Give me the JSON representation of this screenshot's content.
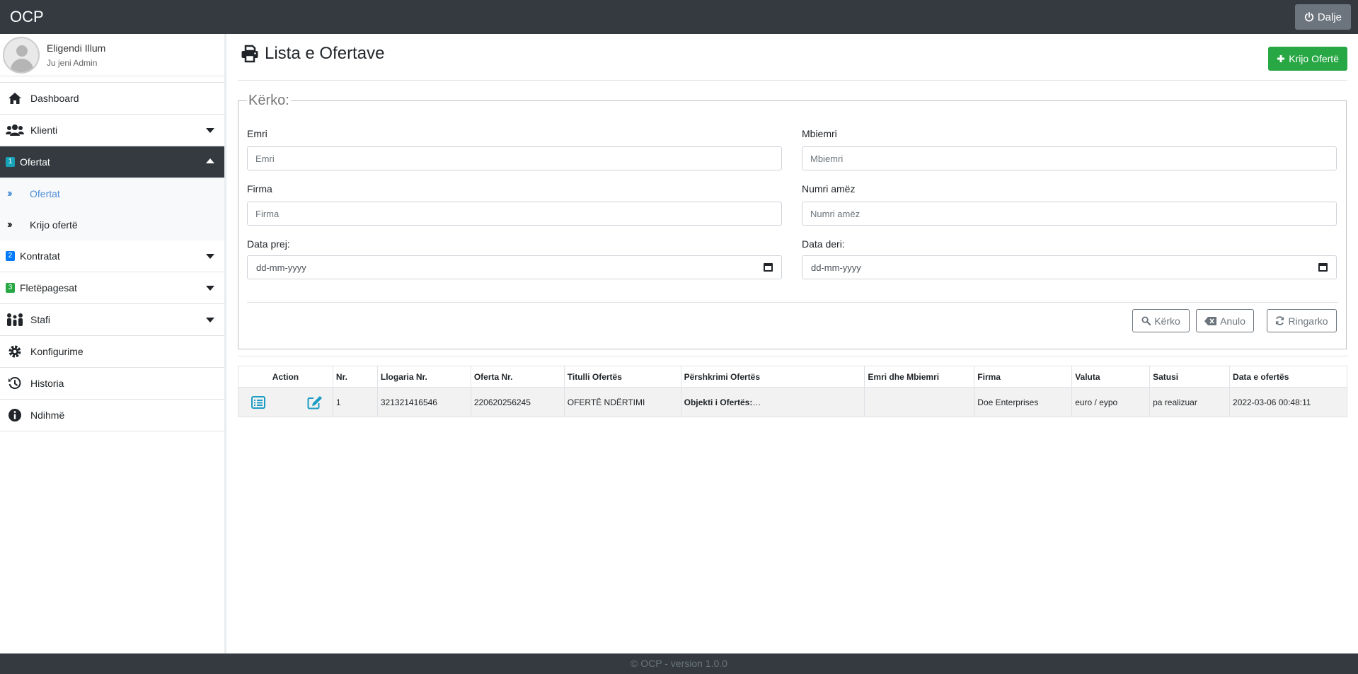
{
  "app": {
    "brand": "OCP"
  },
  "header": {
    "logout_label": "Dalje"
  },
  "user": {
    "name": "Eligendi Illum",
    "role": "Ju jeni Admin"
  },
  "sidebar": {
    "items": [
      {
        "label": "Dashboard"
      },
      {
        "label": "Klienti"
      },
      {
        "label": "Ofertat",
        "badge": "1"
      },
      {
        "label": "Kontratat",
        "badge": "2"
      },
      {
        "label": "Fletëpagesat",
        "badge": "3"
      },
      {
        "label": "Stafi"
      },
      {
        "label": "Konfigurime"
      },
      {
        "label": "Historia"
      },
      {
        "label": "Ndihmë"
      }
    ],
    "submenu": [
      {
        "label": "Ofertat"
      },
      {
        "label": "Krijo ofertë"
      }
    ]
  },
  "page": {
    "title": "Lista e Ofertave",
    "create_label": "Krijo Ofertë"
  },
  "search": {
    "legend": "Kërko:",
    "emri_label": "Emri",
    "emri_placeholder": "Emri",
    "mbiemri_label": "Mbiemri",
    "mbiemri_placeholder": "Mbiemri",
    "firma_label": "Firma",
    "firma_placeholder": "Firma",
    "numri_label": "Numri amëz",
    "numri_placeholder": "Numri amëz",
    "data_prej_label": "Data prej:",
    "data_prej_value": "dd-mm-yyyy",
    "data_deri_label": "Data deri:",
    "data_deri_value": "dd-mm-yyyy",
    "search_btn": "Kërko",
    "cancel_btn": "Anulo",
    "reload_btn": "Ringarko"
  },
  "table": {
    "headers": [
      "Action",
      "Nr.",
      "Llogaria Nr.",
      "Oferta Nr.",
      "Titulli Ofertës",
      "Përshkrimi Ofertës",
      "Emri dhe Mbiemri",
      "Firma",
      "Valuta",
      "Satusi",
      "Data e ofertës"
    ],
    "rows": [
      {
        "nr": "1",
        "llogaria": "321321416546",
        "oferta": "220620256245",
        "titulli": "OFERTË NDËRTIMI",
        "pershkrimi_bold": "Objekti i Ofertës:",
        "pershkrimi_rest": "…",
        "emri": "",
        "firma": "Doe Enterprises",
        "valuta": "euro / eypo",
        "statusi": "pa realizuar",
        "data": "2022-03-06 00:48:11"
      }
    ]
  },
  "footer": {
    "text": "© OCP - version 1.0.0"
  },
  "colors": {
    "topbar": "#343a40",
    "success": "#28a745",
    "active_link": "#4d8fd8",
    "action_icon": "#1c9cc4"
  }
}
